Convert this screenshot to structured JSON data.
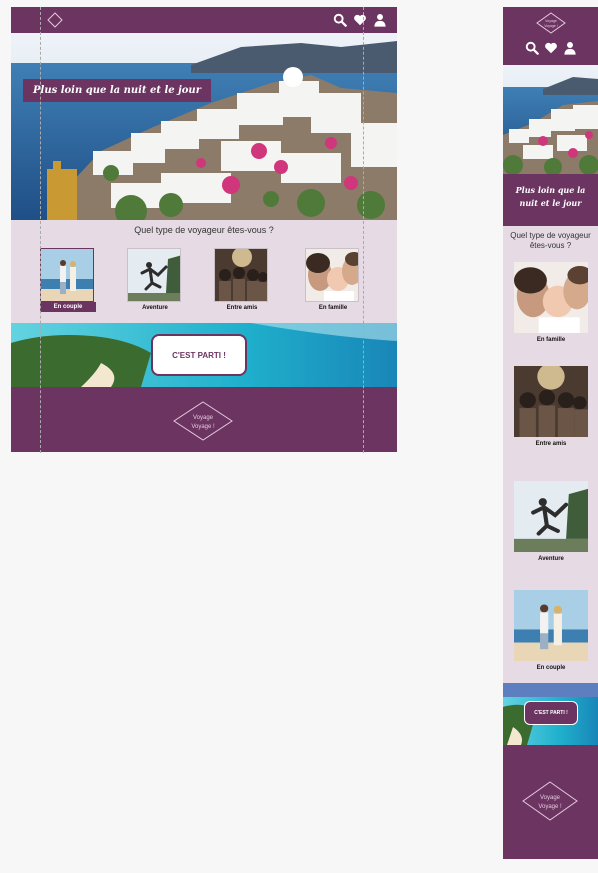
{
  "brand": {
    "line1": "Voyage",
    "line2": "Voyage !"
  },
  "header": {
    "icons": [
      "search-icon",
      "heart-icon",
      "user-icon"
    ]
  },
  "hero": {
    "slogan": "Plus loin que la nuit et le jour"
  },
  "categories": {
    "question": "Quel type de voyageur êtes-vous ?",
    "items": [
      {
        "label": "En couple",
        "selected": true
      },
      {
        "label": "Aventure",
        "selected": false
      },
      {
        "label": "Entre amis",
        "selected": false
      },
      {
        "label": "En famille",
        "selected": false
      }
    ]
  },
  "cta": {
    "label": "C'EST PARTI !"
  },
  "mobile": {
    "question": "Quel type de voyageur êtes-vous ?",
    "items": [
      {
        "label": "En famille"
      },
      {
        "label": "Entre amis"
      },
      {
        "label": "Aventure"
      },
      {
        "label": "En couple"
      }
    ]
  },
  "colors": {
    "primary": "#6b3461",
    "secondary": "#e6dbe4",
    "background": "#f7f7f8"
  }
}
